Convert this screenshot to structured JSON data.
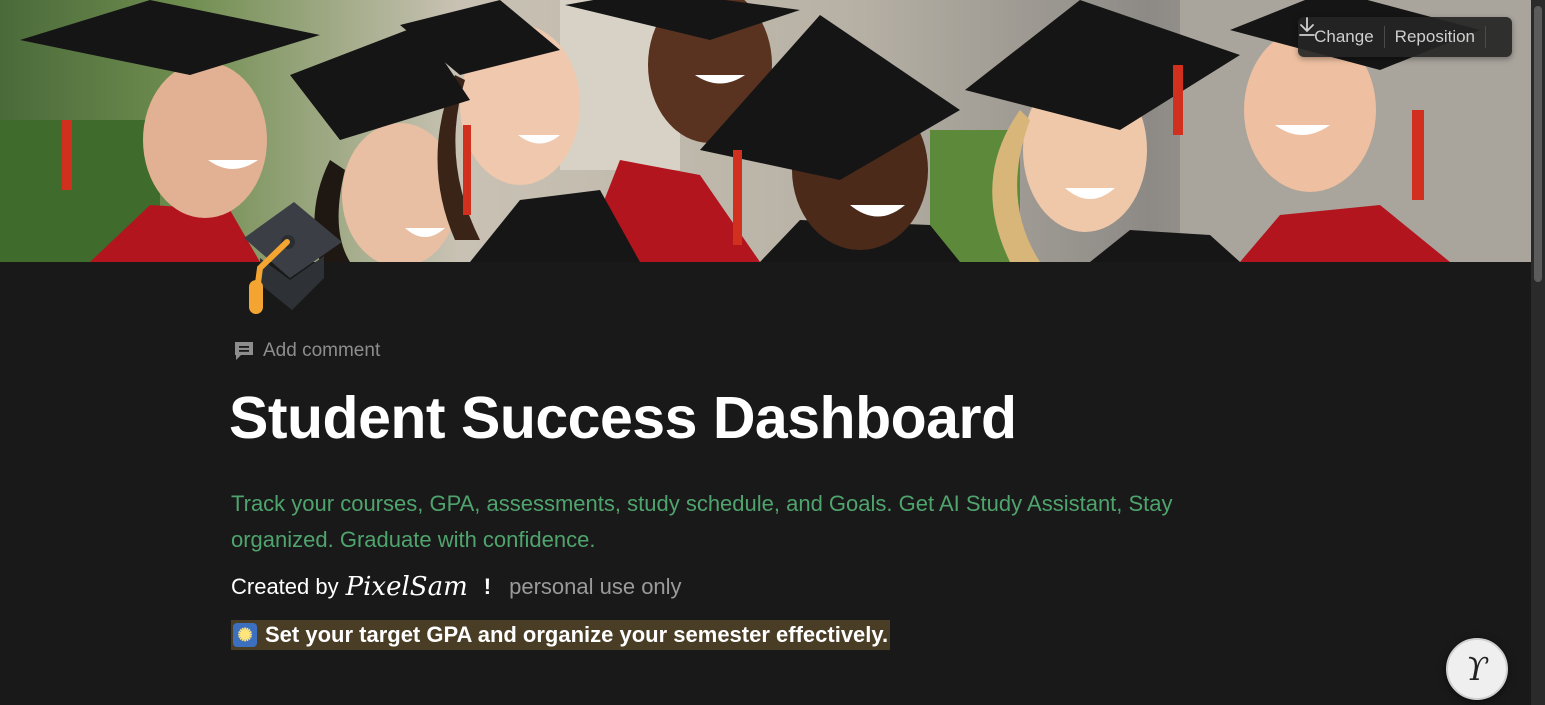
{
  "cover": {
    "controls": {
      "change_label": "Change",
      "reposition_label": "Reposition",
      "download_icon": "download-icon"
    }
  },
  "page": {
    "icon": "graduation-cap-icon",
    "add_comment_label": "Add comment",
    "title": "Student Success Dashboard",
    "description": "Track your  courses, GPA, assessments, study schedule, and Goals. Get AI Study Assistant, Stay organized. Graduate with confidence.",
    "created_by_prefix": "Created by",
    "author": "PixelSam",
    "exclamation": "!",
    "usage_note": "personal use only",
    "callout_icon": "sparkle-icon",
    "callout_text": "Set your target GPA and organize your semester effectively."
  },
  "help_button": {
    "icon": "help-icon",
    "glyph": "ϒ"
  },
  "colors": {
    "background": "#191919",
    "description_green": "#4fa46d",
    "callout_background": "#4a3d26"
  }
}
